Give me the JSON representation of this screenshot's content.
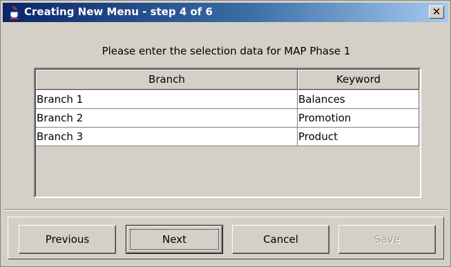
{
  "window": {
    "title": "Creating New Menu - step 4 of 6",
    "close_glyph": "✕",
    "app_icon": "java-coffee-cup-icon"
  },
  "prompt": "Please enter the selection data for MAP Phase 1",
  "table": {
    "columns": [
      "Branch",
      "Keyword"
    ],
    "rows": [
      {
        "branch": "Branch 1",
        "keyword": "Balances"
      },
      {
        "branch": "Branch 2",
        "keyword": "Promotion"
      },
      {
        "branch": "Branch 3",
        "keyword": "Product"
      }
    ]
  },
  "buttons": {
    "previous": "Previous",
    "next": "Next",
    "cancel": "Cancel",
    "save": "Save"
  },
  "colors": {
    "titlebar_start": "#0a246a",
    "titlebar_end": "#a6caf0",
    "face": "#d4d0c8",
    "disabled_text": "#a0a0a0"
  }
}
